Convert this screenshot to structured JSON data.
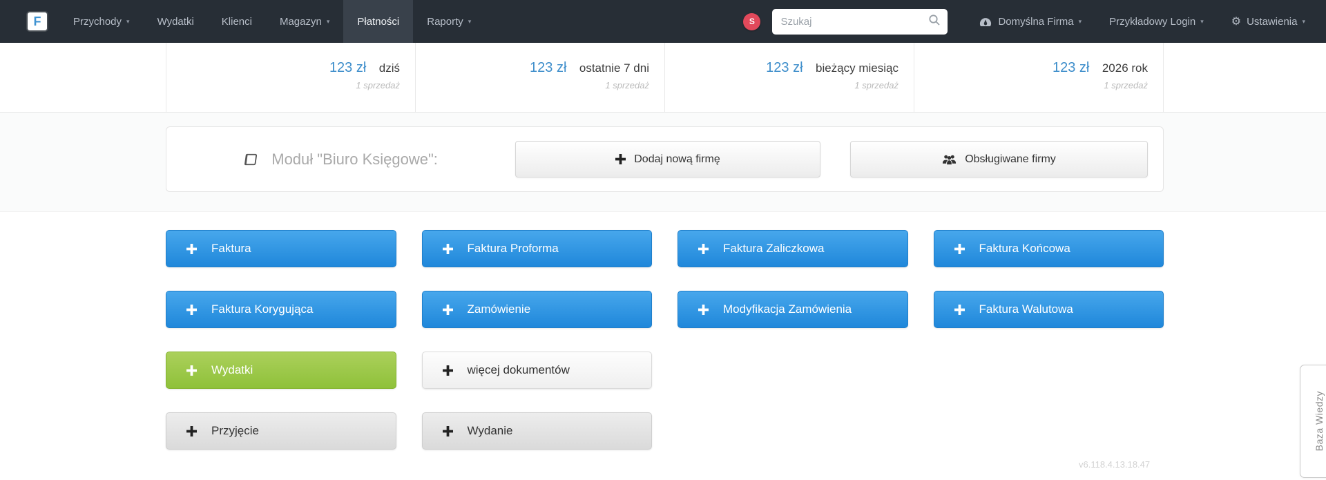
{
  "navbar": {
    "logo_letter": "F",
    "items": [
      {
        "label": "Przychody",
        "caret": true,
        "active": false
      },
      {
        "label": "Wydatki",
        "caret": false,
        "active": false
      },
      {
        "label": "Klienci",
        "caret": false,
        "active": false
      },
      {
        "label": "Magazyn",
        "caret": true,
        "active": false
      },
      {
        "label": "Płatności",
        "caret": false,
        "active": true
      },
      {
        "label": "Raporty",
        "caret": true,
        "active": false
      }
    ],
    "notification_badge": "S",
    "search_placeholder": "Szukaj",
    "company_menu": "Domyślna Firma",
    "user_menu": "Przykładowy Login",
    "settings_menu": "Ustawienia"
  },
  "icons": {
    "caret": "▾",
    "gear": "⚙"
  },
  "stats": {
    "items": [
      {
        "value": "123 zł",
        "label": "dziś",
        "sub": "1 sprzedaż"
      },
      {
        "value": "123 zł",
        "label": "ostatnie 7 dni",
        "sub": "1 sprzedaż"
      },
      {
        "value": "123 zł",
        "label": "bieżący miesiąc",
        "sub": "1 sprzedaż"
      },
      {
        "value": "123 zł",
        "label": "2026 rok",
        "sub": "1 sprzedaż"
      }
    ]
  },
  "module": {
    "title": "Moduł \"Biuro Księgowe\":",
    "add_company_label": "Dodaj nową firmę",
    "supported_companies_label": "Obsługiwane firmy"
  },
  "actions": {
    "buttons": [
      {
        "label": "Faktura",
        "variant": "blue"
      },
      {
        "label": "Faktura Proforma",
        "variant": "blue"
      },
      {
        "label": "Faktura Zaliczkowa",
        "variant": "blue"
      },
      {
        "label": "Faktura Końcowa",
        "variant": "blue"
      },
      {
        "label": "Faktura Korygująca",
        "variant": "blue"
      },
      {
        "label": "Zamówienie",
        "variant": "blue"
      },
      {
        "label": "Modyfikacja Zamówienia",
        "variant": "blue"
      },
      {
        "label": "Faktura Walutowa",
        "variant": "blue"
      },
      {
        "label": "Wydatki",
        "variant": "green"
      },
      {
        "label": "więcej dokumentów",
        "variant": "light"
      },
      {
        "label": "Przyjęcie",
        "variant": "gray"
      },
      {
        "label": "Wydanie",
        "variant": "gray"
      }
    ]
  },
  "footer": {
    "version": "v6.118.4.13.18.47"
  },
  "knowledge_tab_label": "Baza Wiedzy",
  "colors": {
    "navbar_bg": "#272e36",
    "navbar_active_bg": "#39414b",
    "badge_red": "#e2495b",
    "link_blue": "#3e8ecb",
    "button_blue": "#2b93e0",
    "button_green": "#97c23e"
  }
}
